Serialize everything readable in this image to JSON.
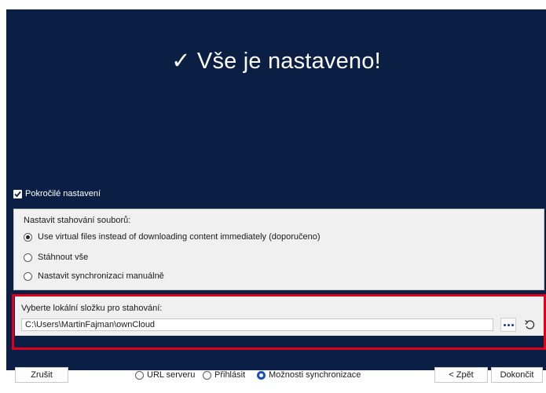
{
  "header": {
    "title": "✓ Vše je nastaveno!"
  },
  "advanced": {
    "label": "Pokročilé nastavení",
    "checked": true
  },
  "download_options": {
    "title": "Nastavit stahování souborů:",
    "options": [
      {
        "label": "Use virtual files instead of downloading content immediately (doporučeno)",
        "selected": true
      },
      {
        "label": "Stáhnout vše",
        "selected": false
      },
      {
        "label": "Nastavit synchronizaci manuálně",
        "selected": false
      }
    ]
  },
  "folder": {
    "title": "Vyberte lokální složku pro stahování:",
    "path": "C:\\Users\\MartinFajman\\ownCloud"
  },
  "footer": {
    "cancel_label": "Zrušit",
    "steps": [
      {
        "label": "URL serveru",
        "selected": false
      },
      {
        "label": "Přihlásit",
        "selected": false
      },
      {
        "label": "Možnosti synchronizace",
        "selected": true
      }
    ],
    "back_label": "< Zpět",
    "finish_label": "Dokončit"
  },
  "colors": {
    "header_bg": "#0b1f45",
    "highlight": "#e0001b",
    "accent": "#1a4fbf"
  }
}
